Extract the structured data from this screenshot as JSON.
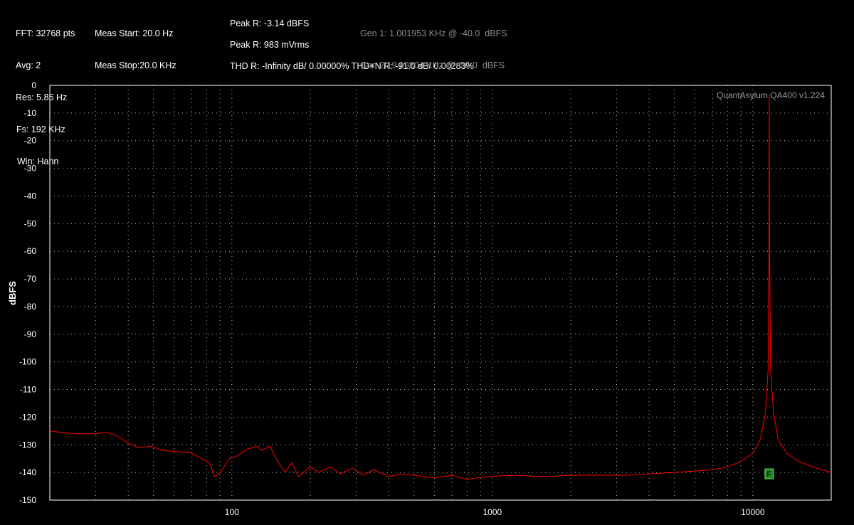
{
  "header": {
    "fft": "FFT: 32768 pts",
    "avg": "Avg: 2",
    "res": "Res: 5.85 Hz",
    "fs": "Fs: 192 KHz",
    "win": "Win: Hann",
    "meas_start": "Meas Start: 20.0 Hz",
    "meas_stop": "Meas Stop:20.0 KHz",
    "peak_r_dbfs": "Peak R: -3.14 dBFS",
    "peak_r_mv": "Peak R: 983 mVrms",
    "thd": "THD R: -Infinity dB/ 0.00000% THD+N R: -91.0 dB/ 0.00283%",
    "gen1": "Gen 1: 1.001953 KHz @ -40.0  dBFS",
    "gen2": "Gen 2:19.99804 KHz @ -20.0  dBFS"
  },
  "watermark": "QuantAsylum QA400 v1.224",
  "marker_label": "F",
  "chart_data": {
    "type": "line",
    "title": "",
    "xlabel": "",
    "ylabel": "dBFS",
    "x_scale": "log",
    "xlim": [
      20,
      20000
    ],
    "ylim": [
      -150,
      0
    ],
    "x_ticks": [
      100,
      1000,
      10000
    ],
    "x_tick_labels": [
      "100",
      "1000",
      "10000"
    ],
    "y_ticks": [
      0,
      -10,
      -20,
      -30,
      -40,
      -50,
      -60,
      -70,
      -80,
      -90,
      -100,
      -110,
      -120,
      -130,
      -140,
      -150
    ],
    "y_tick_labels": [
      "0",
      "-10",
      "-20",
      "-30",
      "-40",
      "-50",
      "-60",
      "-70",
      "-80",
      "-90",
      "-100",
      "-110",
      "-120",
      "-130",
      "-140",
      "-150"
    ],
    "grid": true,
    "line_color": "#ff0000",
    "grid_color": "#bfbfbf",
    "series": [
      {
        "values": [
          [
            20,
            -125
          ],
          [
            22,
            -125.5
          ],
          [
            25,
            -126
          ],
          [
            30,
            -126
          ],
          [
            33,
            -125.5
          ],
          [
            36,
            -126.5
          ],
          [
            40,
            -129.5
          ],
          [
            44,
            -131
          ],
          [
            49,
            -130.5
          ],
          [
            54,
            -132
          ],
          [
            62,
            -132.5
          ],
          [
            70,
            -133
          ],
          [
            75,
            -134.5
          ],
          [
            82,
            -136.5
          ],
          [
            86,
            -141.5
          ],
          [
            90,
            -140
          ],
          [
            98,
            -135
          ],
          [
            105,
            -134
          ],
          [
            115,
            -131.5
          ],
          [
            125,
            -130.5
          ],
          [
            130,
            -132
          ],
          [
            140,
            -130.5
          ],
          [
            150,
            -136
          ],
          [
            160,
            -140
          ],
          [
            170,
            -136.5
          ],
          [
            180,
            -141.5
          ],
          [
            200,
            -138
          ],
          [
            215,
            -140
          ],
          [
            240,
            -138
          ],
          [
            260,
            -140.5
          ],
          [
            290,
            -138.5
          ],
          [
            320,
            -141
          ],
          [
            350,
            -139
          ],
          [
            400,
            -141.5
          ],
          [
            450,
            -140.5
          ],
          [
            500,
            -141
          ],
          [
            600,
            -142
          ],
          [
            700,
            -141
          ],
          [
            800,
            -142.5
          ],
          [
            950,
            -141.5
          ],
          [
            1200,
            -141
          ],
          [
            1600,
            -141.5
          ],
          [
            2000,
            -141
          ],
          [
            2600,
            -141
          ],
          [
            3300,
            -141
          ],
          [
            4000,
            -140.5
          ],
          [
            5000,
            -140
          ],
          [
            6000,
            -139.5
          ],
          [
            7000,
            -139
          ],
          [
            8000,
            -138
          ],
          [
            9000,
            -136
          ],
          [
            10000,
            -133
          ],
          [
            10700,
            -128
          ],
          [
            11200,
            -118
          ],
          [
            11450,
            -103
          ],
          [
            11530,
            -60
          ],
          [
            11560,
            -3.14
          ],
          [
            11600,
            -60
          ],
          [
            11700,
            -103
          ],
          [
            12000,
            -118
          ],
          [
            12500,
            -128
          ],
          [
            13500,
            -133
          ],
          [
            15000,
            -136
          ],
          [
            17000,
            -138
          ],
          [
            20000,
            -140
          ]
        ]
      }
    ],
    "markers": [
      {
        "x": 11560,
        "y": -140.5,
        "color": "#1e8c1e",
        "label": "F"
      }
    ]
  }
}
